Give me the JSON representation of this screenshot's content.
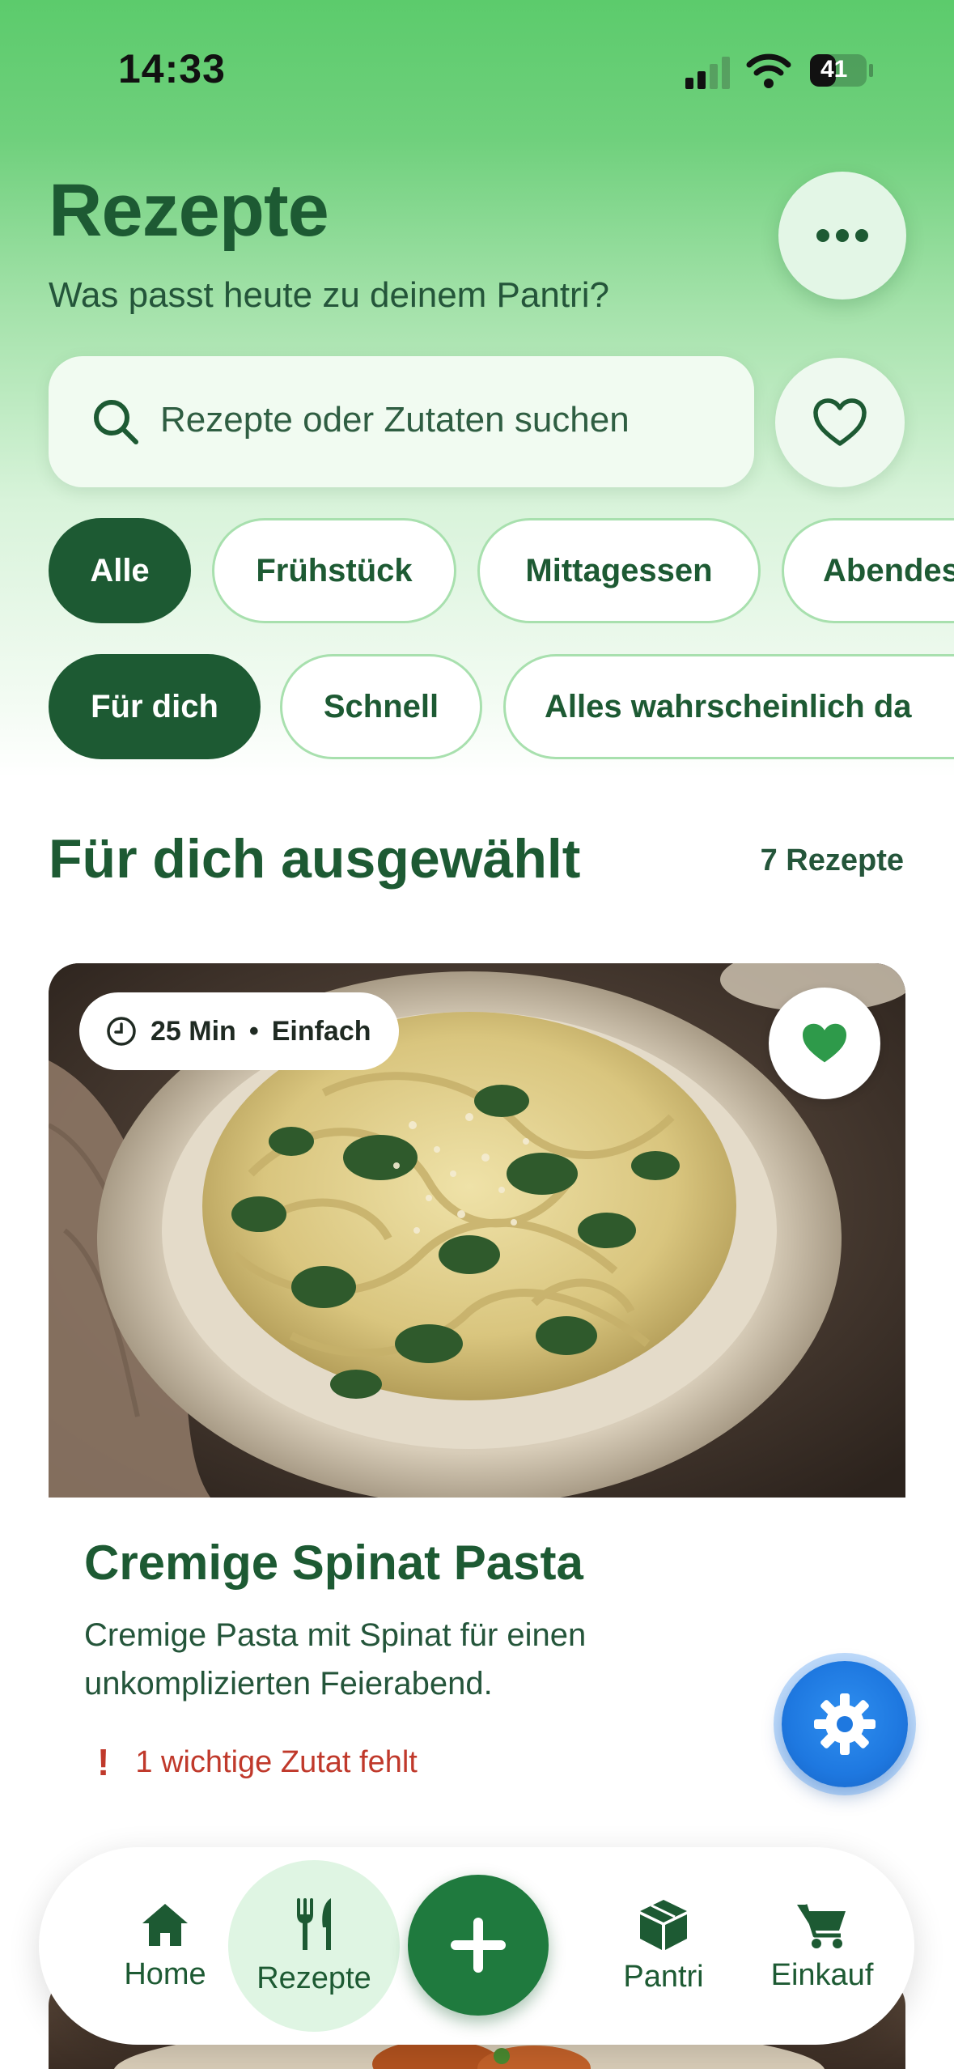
{
  "status": {
    "time": "14:33",
    "battery": "41"
  },
  "header": {
    "title": "Rezepte",
    "subtitle": "Was passt heute zu deinem Pantri?",
    "more_icon": "ellipsis-icon"
  },
  "search": {
    "placeholder": "Rezepte oder Zutaten suchen",
    "icon": "search-icon",
    "favorites_icon": "heart-outline-icon"
  },
  "meal_filters": [
    {
      "label": "Alle",
      "active": true
    },
    {
      "label": "Frühstück",
      "active": false
    },
    {
      "label": "Mittagessen",
      "active": false
    },
    {
      "label": "Abendessen",
      "active": false
    }
  ],
  "smart_filters": [
    {
      "label": "Für dich",
      "active": true
    },
    {
      "label": "Schnell",
      "active": false
    },
    {
      "label": "Alles wahrscheinlich da",
      "active": false
    }
  ],
  "section": {
    "title": "Für dich ausgewählt",
    "count": "7 Rezepte"
  },
  "recipe": {
    "time": "25 Min",
    "separator": "•",
    "difficulty": "Einfach",
    "title": "Cremige Spinat Pasta",
    "description": "Cremige Pasta mit Spinat für einen unkomplizierten Feierabend.",
    "missing_icon": "!",
    "missing": "1 wichtige Zutat fehlt",
    "favorited": true
  },
  "tabs": [
    {
      "label": "Home",
      "icon": "home-icon"
    },
    {
      "label": "Rezepte",
      "icon": "fork-knife-icon",
      "active": true
    },
    {
      "label": "",
      "icon": "plus-icon"
    },
    {
      "label": "Pantri",
      "icon": "box-icon"
    },
    {
      "label": "Einkauf",
      "icon": "cart-icon"
    }
  ],
  "colors": {
    "primary": "#1d5a33",
    "accent": "#1f7a3e",
    "warning": "#c0392b",
    "fab": "#1e78e0"
  }
}
